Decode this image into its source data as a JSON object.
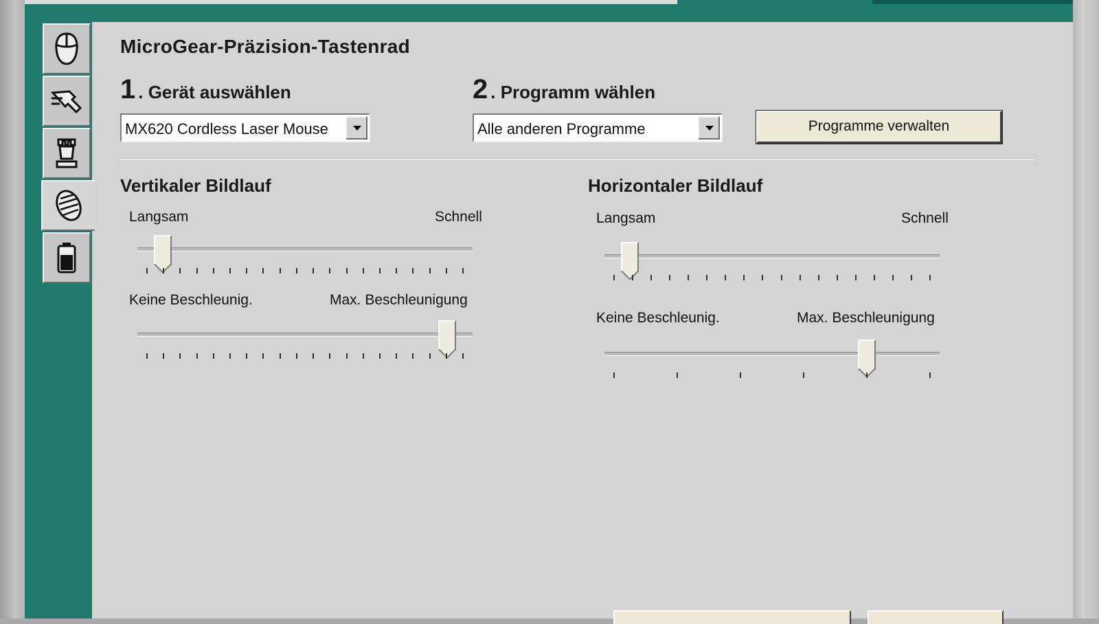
{
  "page_title": "MicroGear-Präzision-Tastenrad",
  "nav_tabs": [
    {
      "icon": "mouse-icon",
      "active": false
    },
    {
      "icon": "pointer-icon",
      "active": false
    },
    {
      "icon": "chess-rook-icon",
      "active": false
    },
    {
      "icon": "scroll-wheel-icon",
      "active": true
    },
    {
      "icon": "battery-icon",
      "active": false
    }
  ],
  "step1": {
    "number": "1",
    "label": ". Gerät auswählen",
    "device_value": "MX620 Cordless Laser Mouse"
  },
  "step2": {
    "number": "2",
    "label": ". Programm wählen",
    "program_value": "Alle anderen Programme"
  },
  "manage_programs_button": "Programme verwalten",
  "vertical": {
    "title": "Vertikaler Bildlauf",
    "speed": {
      "min_label": "Langsam",
      "max_label": "Schnell",
      "value": 0.05,
      "ticks": 20
    },
    "accel": {
      "min_label": "Keine Beschleunig.",
      "max_label": "Max. Beschleunigung",
      "value": 0.95,
      "ticks": 20
    }
  },
  "horizontal": {
    "title": "Horizontaler Bildlauf",
    "speed": {
      "min_label": "Langsam",
      "max_label": "Schnell",
      "value": 0.05,
      "ticks": 18
    },
    "accel": {
      "min_label": "Keine Beschleunig.",
      "max_label": "Max. Beschleunigung",
      "value": 0.8,
      "ticks": 6
    }
  },
  "colors": {
    "frame": "#207a6c",
    "panel": "#d4d4d4",
    "button": "#ede9d6"
  }
}
